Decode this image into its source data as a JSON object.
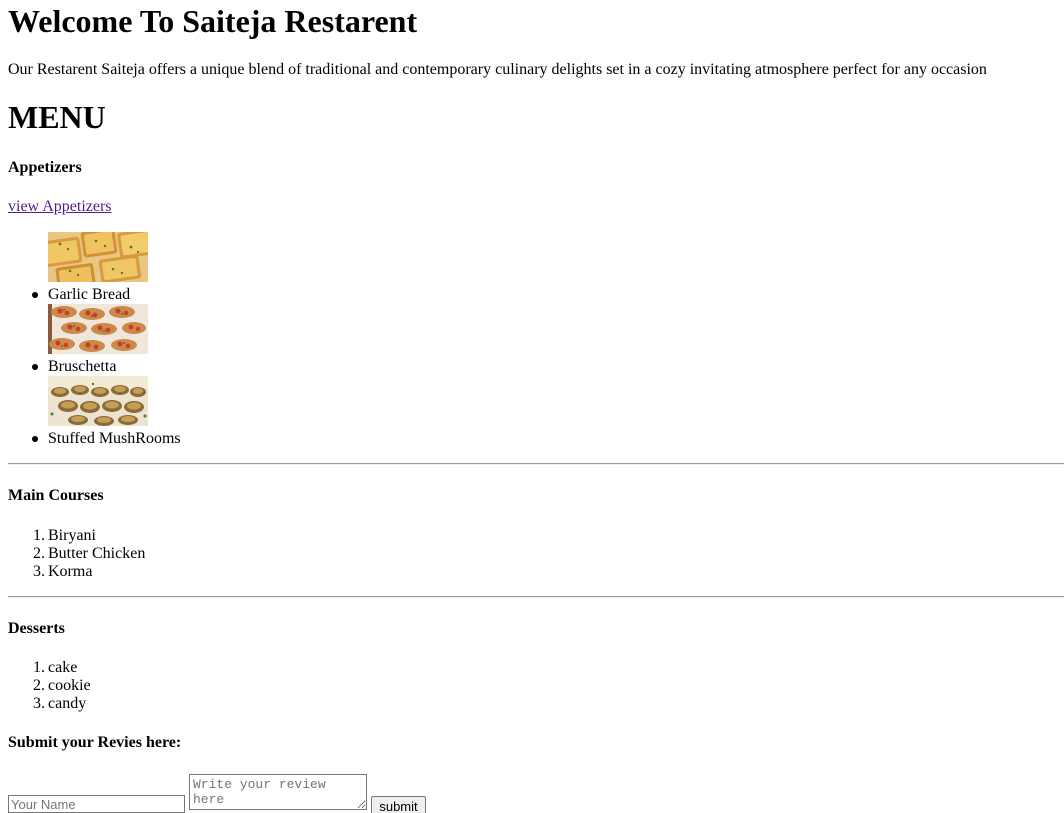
{
  "header": {
    "title": "Welcome To Saiteja Restarent",
    "intro": "Our Restarent Saiteja offers a unique blend of traditional and contemporary culinary delights set in a cozy invitating atmosphere perfect for any occasion"
  },
  "menu": {
    "title": "MENU",
    "appetizers": {
      "heading": "Appetizers",
      "link_label": "view Appetizers",
      "items": [
        {
          "label": "Garlic Bread",
          "icon": "garlic-bread-image"
        },
        {
          "label": "Bruschetta",
          "icon": "bruschetta-image"
        },
        {
          "label": "Stuffed MushRooms",
          "icon": "stuffed-mushrooms-image"
        }
      ]
    },
    "main_courses": {
      "heading": "Main Courses",
      "items": [
        {
          "num": "1.",
          "label": "Biryani"
        },
        {
          "num": "2.",
          "label": "Butter Chicken"
        },
        {
          "num": "3.",
          "label": "Korma"
        }
      ]
    },
    "desserts": {
      "heading": "Desserts",
      "items": [
        {
          "num": "1.",
          "label": "cake"
        },
        {
          "num": "2.",
          "label": "cookie"
        },
        {
          "num": "3.",
          "label": "candy"
        }
      ]
    }
  },
  "review": {
    "heading": "Submit your Revies here:",
    "name_placeholder": "Your Name",
    "name_value": "",
    "review_placeholder": "Write your review here",
    "review_value": "",
    "submit_label": "submit"
  },
  "colors": {
    "link_visited": "#551a8b",
    "hr": "#9a9a9a",
    "button_bg": "#efefef"
  }
}
